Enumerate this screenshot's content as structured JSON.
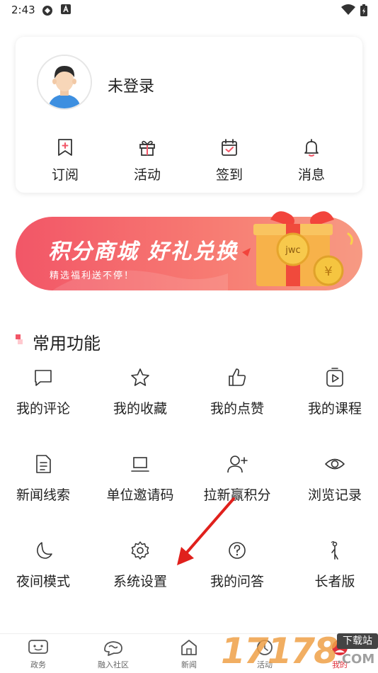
{
  "status_bar": {
    "time": "2:43"
  },
  "profile": {
    "login_text": "未登录"
  },
  "quick_actions": [
    {
      "label": "订阅",
      "icon": "bookmark-plus-icon"
    },
    {
      "label": "活动",
      "icon": "gift-icon"
    },
    {
      "label": "签到",
      "icon": "calendar-check-icon"
    },
    {
      "label": "消息",
      "icon": "bell-icon"
    }
  ],
  "banner": {
    "title": "积分商城 好礼兑换",
    "subtitle": "精选福利送不停！",
    "gift_logo": "jwc"
  },
  "section": {
    "title": "常用功能"
  },
  "functions": [
    {
      "label": "我的评论",
      "icon": "comment-icon"
    },
    {
      "label": "我的收藏",
      "icon": "star-icon"
    },
    {
      "label": "我的点赞",
      "icon": "thumbs-up-icon"
    },
    {
      "label": "我的课程",
      "icon": "course-play-icon"
    },
    {
      "label": "新闻线索",
      "icon": "document-icon"
    },
    {
      "label": "单位邀请码",
      "icon": "laptop-icon"
    },
    {
      "label": "拉新赢积分",
      "icon": "add-user-icon"
    },
    {
      "label": "浏览记录",
      "icon": "eye-icon"
    },
    {
      "label": "夜间模式",
      "icon": "moon-icon"
    },
    {
      "label": "系统设置",
      "icon": "gear-icon"
    },
    {
      "label": "我的问答",
      "icon": "question-icon"
    },
    {
      "label": "长者版",
      "icon": "elder-mode-icon"
    }
  ],
  "tab_bar": [
    {
      "label": "政务",
      "icon": "gov-icon"
    },
    {
      "label": "融入社区",
      "icon": "community-icon"
    },
    {
      "label": "新闻",
      "icon": "home-icon"
    },
    {
      "label": "活动",
      "icon": "activity-icon"
    },
    {
      "label": "我的",
      "icon": "profile-icon"
    }
  ],
  "watermark": {
    "number": "17178",
    "badge": "下载站",
    "domain": ".COM"
  },
  "colors": {
    "accent": "#f25667",
    "text": "#222222",
    "tab_text": "#666666",
    "arrow": "#e0201c"
  }
}
